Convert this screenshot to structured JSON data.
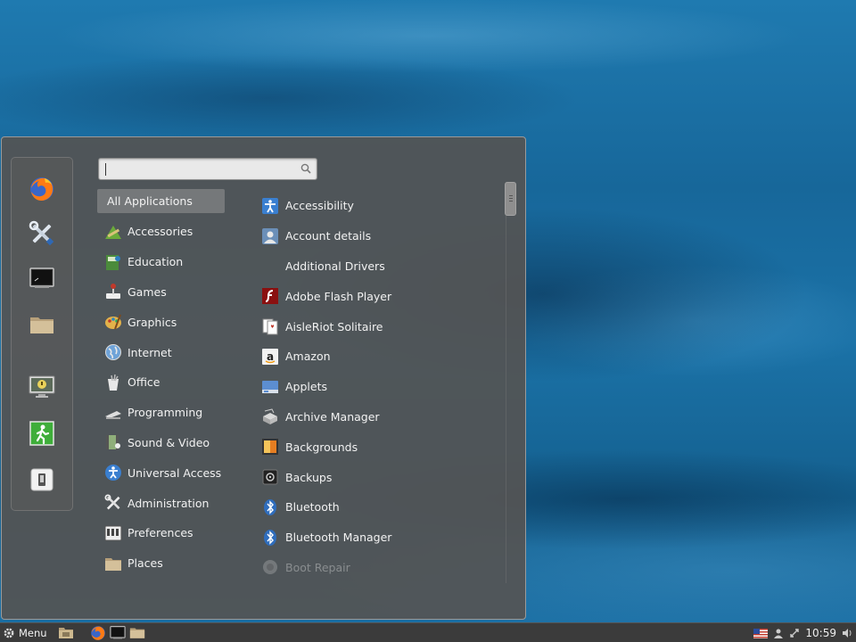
{
  "search": {
    "value": "",
    "placeholder": ""
  },
  "favorites": [
    {
      "name": "firefox-icon",
      "icon": "firefox"
    },
    {
      "name": "settings-icon",
      "icon": "tools"
    },
    {
      "name": "terminal-icon",
      "icon": "terminal"
    },
    {
      "name": "files-icon",
      "icon": "folder"
    },
    {
      "name": "lock-screen-icon",
      "icon": "lock-screen"
    },
    {
      "name": "logout-icon",
      "icon": "exit"
    },
    {
      "name": "shutdown-icon",
      "icon": "shutdown"
    }
  ],
  "categories": [
    {
      "label": "All Applications",
      "icon": "none"
    },
    {
      "label": "Accessories",
      "icon": "accessories"
    },
    {
      "label": "Education",
      "icon": "education"
    },
    {
      "label": "Games",
      "icon": "games"
    },
    {
      "label": "Graphics",
      "icon": "graphics"
    },
    {
      "label": "Internet",
      "icon": "internet"
    },
    {
      "label": "Office",
      "icon": "office"
    },
    {
      "label": "Programming",
      "icon": "programming"
    },
    {
      "label": "Sound & Video",
      "icon": "sound-video"
    },
    {
      "label": "Universal Access",
      "icon": "universal-access"
    },
    {
      "label": "Administration",
      "icon": "administration"
    },
    {
      "label": "Preferences",
      "icon": "preferences"
    },
    {
      "label": "Places",
      "icon": "places"
    }
  ],
  "applications": [
    {
      "label": "Accessibility",
      "icon": "accessibility"
    },
    {
      "label": "Account details",
      "icon": "account"
    },
    {
      "label": "Additional Drivers",
      "icon": "none"
    },
    {
      "label": "Adobe Flash Player",
      "icon": "flash"
    },
    {
      "label": "AisleRiot Solitaire",
      "icon": "cards"
    },
    {
      "label": "Amazon",
      "icon": "amazon"
    },
    {
      "label": "Applets",
      "icon": "applets"
    },
    {
      "label": "Archive Manager",
      "icon": "archive"
    },
    {
      "label": "Backgrounds",
      "icon": "backgrounds"
    },
    {
      "label": "Backups",
      "icon": "backups"
    },
    {
      "label": "Bluetooth",
      "icon": "bluetooth"
    },
    {
      "label": "Bluetooth Manager",
      "icon": "bluetooth"
    },
    {
      "label": "Boot Repair",
      "icon": "boot-repair"
    }
  ],
  "panel": {
    "menu_label": "Menu",
    "clock": "10:59",
    "launchers": [
      "files",
      "firefox",
      "terminal",
      "folder"
    ],
    "tray": [
      "us-flag",
      "user",
      "network",
      "volume"
    ]
  }
}
